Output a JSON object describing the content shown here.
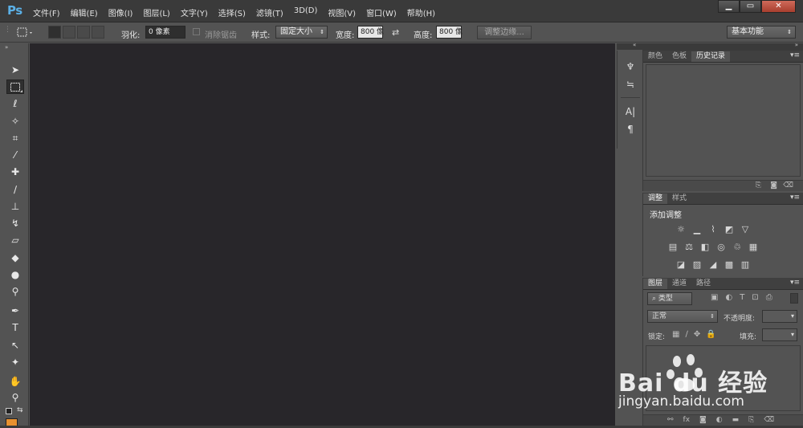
{
  "app": {
    "logo": "Ps"
  },
  "menu": [
    "文件(F)",
    "编辑(E)",
    "图像(I)",
    "图层(L)",
    "文字(Y)",
    "选择(S)",
    "滤镜(T)",
    "3D(D)",
    "视图(V)",
    "窗口(W)",
    "帮助(H)"
  ],
  "window_controls": {
    "minimize": "▁",
    "maximize": "▭",
    "close": "✕"
  },
  "options": {
    "feather_label": "羽化:",
    "feather_value": "0 像素",
    "antialias_label": "消除锯齿",
    "style_label": "样式:",
    "style_value": "固定大小",
    "width_label": "宽度:",
    "width_value": "800 像",
    "height_label": "高度:",
    "height_value": "800 像",
    "refine_edge": "调整边缘...",
    "workspace": "基本功能"
  },
  "panels": {
    "top_tabs": [
      "颜色",
      "色板",
      "历史记录"
    ],
    "top_active": "历史记录",
    "adjust_tabs": [
      "调整",
      "样式"
    ],
    "adjust_active": "调整",
    "adjust_title": "添加调整",
    "layers_tabs": [
      "图层",
      "通道",
      "路径"
    ],
    "layers_active": "图层",
    "layers_kind": "类型",
    "blend_mode": "正常",
    "opacity_label": "不透明度:",
    "lock_label": "锁定:",
    "fill_label": "填充:"
  },
  "watermark": {
    "brand": "Bai du 经验",
    "url": "jingyan.baidu.com"
  },
  "colors": {
    "canvas": "#28262a",
    "ui": "#535353",
    "accent_fg": "#e8912f"
  }
}
